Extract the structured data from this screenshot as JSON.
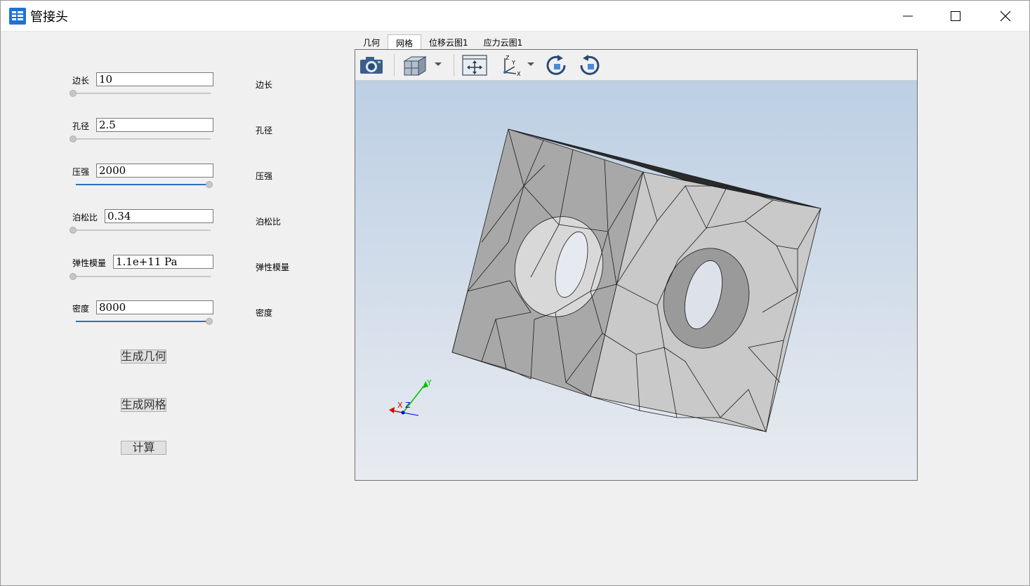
{
  "window": {
    "title": "管接头",
    "icon": "app-logo-icon",
    "controls": [
      "minimize-icon",
      "maximize-icon",
      "close-icon"
    ]
  },
  "params": [
    {
      "label": "边长",
      "value": "10",
      "right_label": "边长",
      "slider_fraction": 0.0,
      "slider_filled": false
    },
    {
      "label": "孔径",
      "value": "2.5",
      "right_label": "孔径",
      "slider_fraction": 0.0,
      "slider_filled": false
    },
    {
      "label": "压强",
      "value": "2000",
      "right_label": "压强",
      "slider_fraction": 1.0,
      "slider_filled": true
    },
    {
      "label": "泊松比",
      "value": "0.34",
      "right_label": "泊松比",
      "slider_fraction": 0.0,
      "slider_filled": false
    },
    {
      "label": "弹性模量",
      "value": "1.1e+11 Pa",
      "right_label": "弹性模量",
      "slider_fraction": 0.0,
      "slider_filled": false
    },
    {
      "label": "密度",
      "value": "8000",
      "right_label": "密度",
      "slider_fraction": 1.0,
      "slider_filled": true
    }
  ],
  "buttons": {
    "gen_geometry": "生成几何",
    "gen_mesh": "生成网格",
    "compute": "计算"
  },
  "tabs": [
    {
      "label": "几何",
      "active": false
    },
    {
      "label": "网格",
      "active": true
    },
    {
      "label": "位移云图1",
      "active": false
    },
    {
      "label": "应力云图1",
      "active": false
    }
  ],
  "toolbar": {
    "icons": [
      "camera-icon",
      "view-cube-icon",
      "fit-view-icon",
      "axes-icon",
      "rotate-cw-icon",
      "rotate-ccw-icon"
    ]
  },
  "axes_triad": {
    "x": "X",
    "y": "Y",
    "z": "Z"
  },
  "colors": {
    "accent": "#2a6fc9",
    "viewport_top": "#b9cde3",
    "viewport_bottom": "#e8ebf0"
  }
}
